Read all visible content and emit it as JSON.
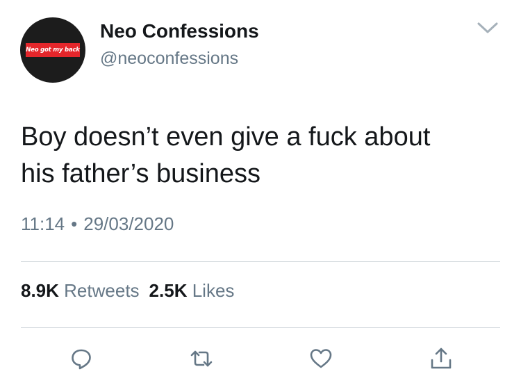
{
  "profile": {
    "display_name": "Neo Confessions",
    "handle": "@neoconfessions",
    "avatar_text": "Neo got my back"
  },
  "tweet": {
    "lines": [
      "Boy doesn’t even give a fuck about",
      "his father’s business"
    ],
    "time": "11:14",
    "separator": "•",
    "date": "29/03/2020"
  },
  "stats": {
    "retweets_count": "8.9K",
    "retweets_label": "Retweets",
    "likes_count": "2.5K",
    "likes_label": "Likes"
  },
  "icons": {
    "more": "chevron-down-icon",
    "reply": "reply-icon",
    "retweet": "retweet-icon",
    "like": "heart-icon",
    "share": "share-icon"
  },
  "colors": {
    "text_primary": "#14171a",
    "text_secondary": "#657786",
    "icon_gray": "#657786",
    "avatar_background": "#1c1c1c",
    "avatar_label_red": "#e4262b"
  }
}
